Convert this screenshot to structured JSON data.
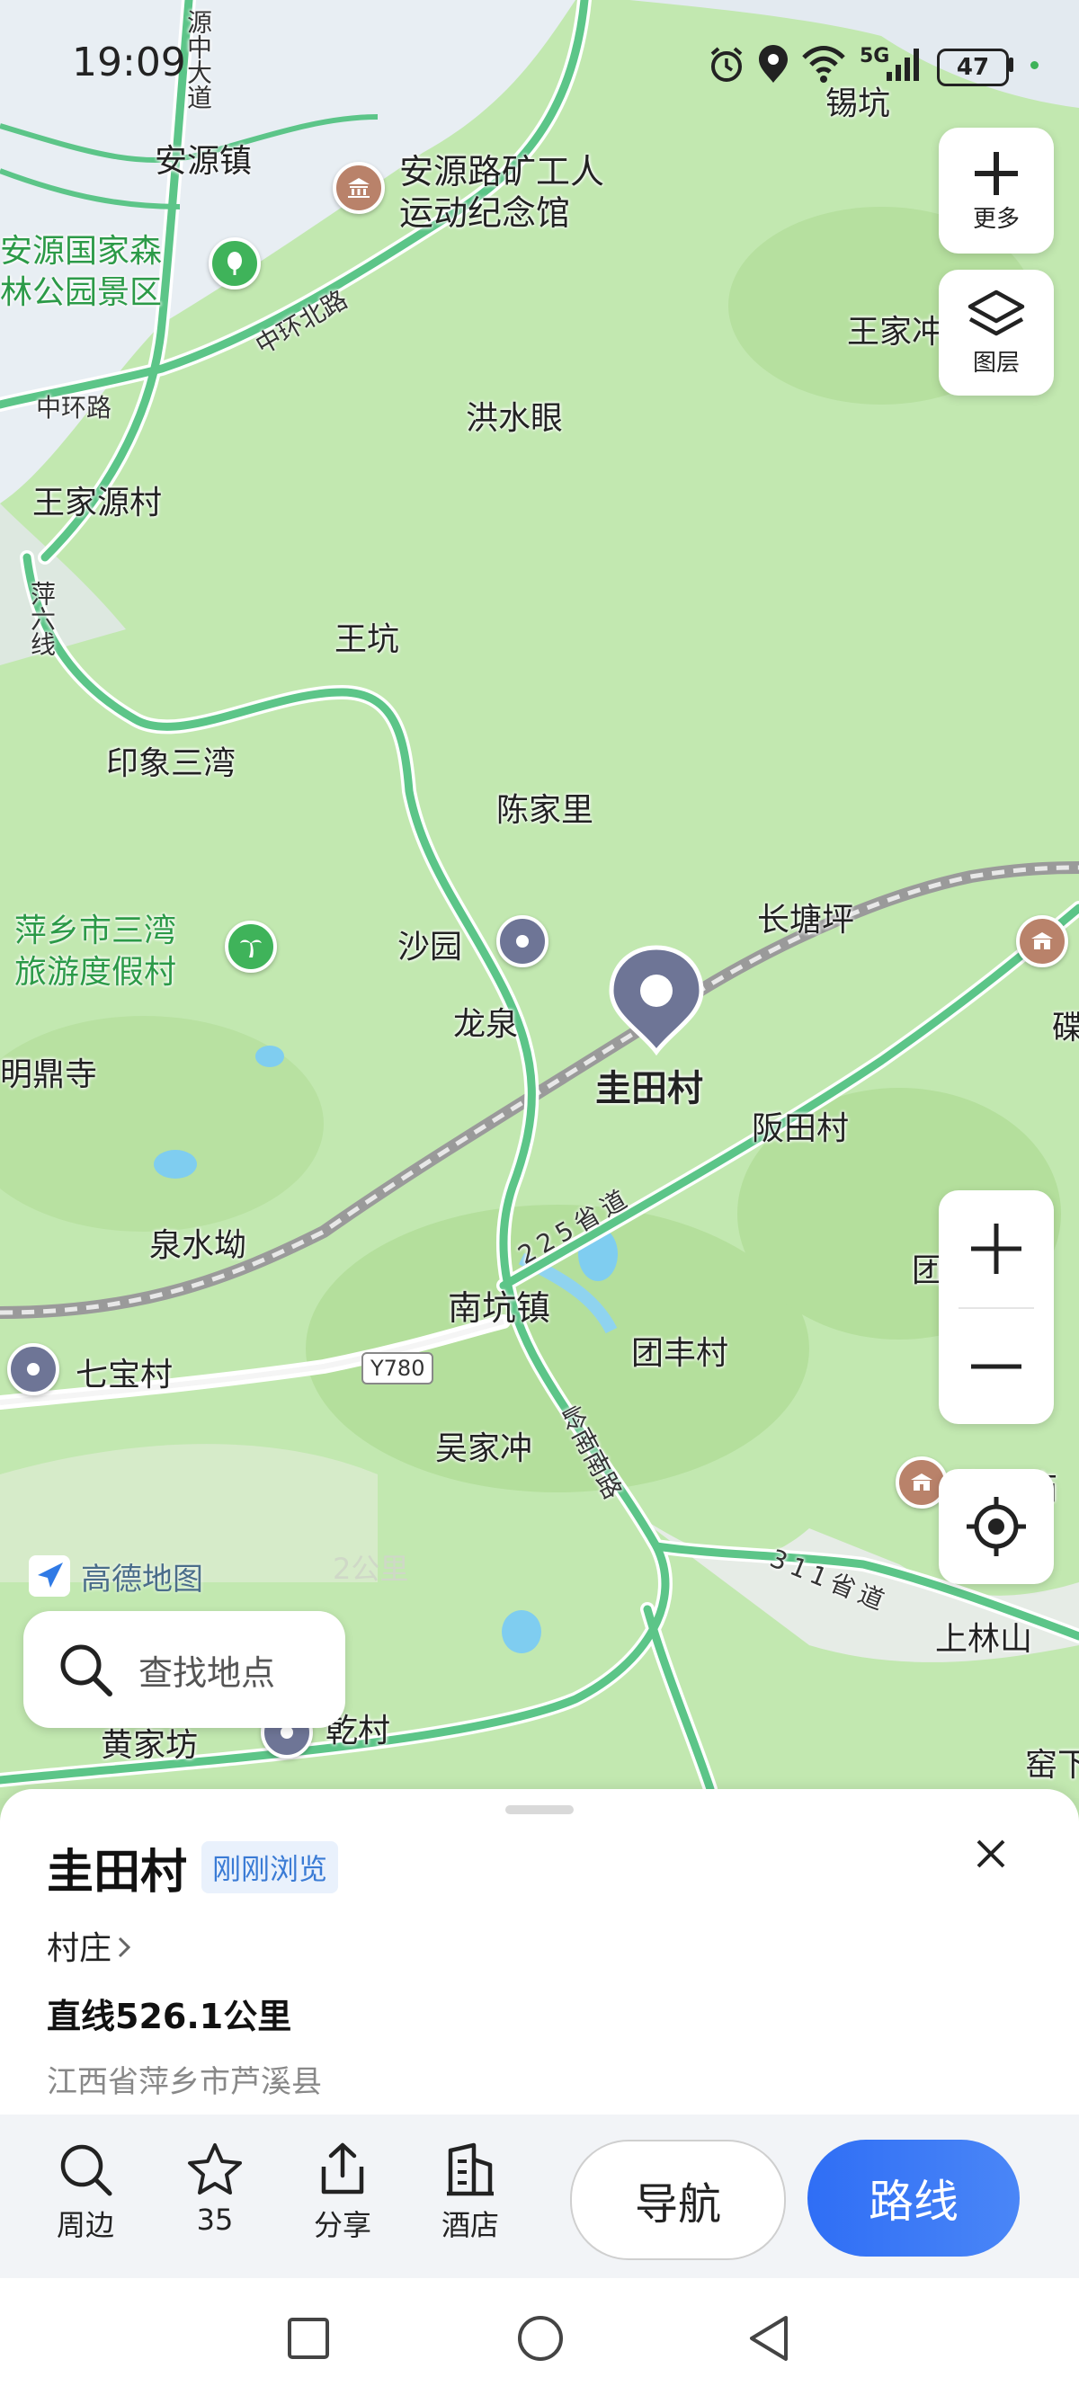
{
  "status": {
    "time": "19:09",
    "battery": "47",
    "network": "5G"
  },
  "map": {
    "places": {
      "anyuan_town": "安源镇",
      "museum_l1": "安源路矿工人",
      "museum_l2": "运动纪念馆",
      "forest_l1": "安源国家森",
      "forest_l2": "林公园景区",
      "xikeng": "锡坑",
      "wangjia_r": "王家冲",
      "hongshuiyan": "洪水眼",
      "wangjiayuan": "王家源村",
      "wangkeng": "王坑",
      "yinxiang": "印象三湾",
      "chenjiali": "陈家里",
      "resort_l1": "萍乡市三湾",
      "resort_l2": "旅游度假村",
      "shayuan": "沙园",
      "longquan": "龙泉",
      "changtangping": "长塘坪",
      "guitian": "圭田村",
      "bantian": "阪田村",
      "temple": "明鼎寺",
      "quanshuiao": "泉水坳",
      "nankeng": "南坑镇",
      "qibao": "七宝村",
      "tuanfeng": "团丰村",
      "wujiachong": "吴家冲",
      "shanglin": "上林山",
      "huangjia": "黄家坊",
      "qiancun": "乾村",
      "right_tuan": "团",
      "right_die": "碟",
      "right_miao": "龙王庙",
      "right_yao": "窑下"
    },
    "roads": {
      "yuan_zhong": "源中大道",
      "zhonghuan_n": "中环北路",
      "zhonghuan": "中环路",
      "pingliu": "萍六线",
      "s225": "225省道",
      "y780": "Y780",
      "lingnan": "岭南南路",
      "s311": "311省道"
    },
    "brand": "高德地图",
    "scale": "2公里"
  },
  "controls": {
    "more": "更多",
    "layers": "图层"
  },
  "search": {
    "placeholder": "查找地点"
  },
  "sheet": {
    "name": "圭田村",
    "tag": "刚刚浏览",
    "category": "村庄",
    "distance": "直线526.1公里",
    "address": "江西省萍乡市芦溪县"
  },
  "actions": {
    "nearby": "周边",
    "favorites": "35",
    "share": "分享",
    "hotel": "酒店",
    "navigate": "导航",
    "route": "路线"
  }
}
